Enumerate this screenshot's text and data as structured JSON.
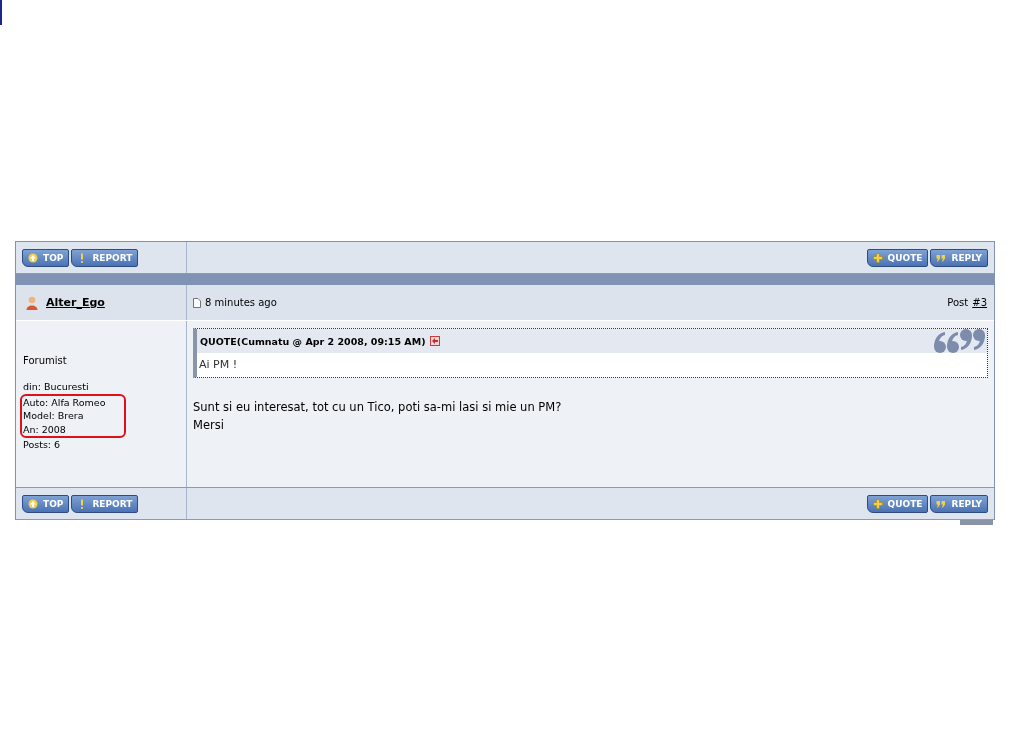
{
  "post": {
    "top_bar": {
      "left_buttons": [
        {
          "kind": "top",
          "label": "TOP"
        },
        {
          "kind": "report",
          "label": "REPORT"
        }
      ],
      "right_buttons": [
        {
          "kind": "quote",
          "label": "QUOTE"
        },
        {
          "kind": "reply",
          "label": "REPLY"
        }
      ]
    },
    "author": {
      "name": "Alter_Ego",
      "group": "Forumist",
      "profile": [
        {
          "text": "din: Bucuresti",
          "highlighted": false
        },
        {
          "text": "Auto: Alfa Romeo",
          "highlighted": true
        },
        {
          "text": "Model: Brera",
          "highlighted": true
        },
        {
          "text": "An: 2008",
          "highlighted": true
        },
        {
          "text": "Posts: 6",
          "highlighted": false
        }
      ]
    },
    "time": "8 minutes ago",
    "post_label": "Post",
    "post_number": "#3",
    "quote": {
      "header": "QUOTE(Cumnatu @ Apr 2 2008, 09:15 AM)",
      "text": "Ai PM !"
    },
    "body": [
      "Sunt si eu interesat, tot cu un Tico, poti sa-mi lasi si mie un PM?",
      "Mersi"
    ],
    "bottom_bar": {
      "left_buttons": [
        {
          "kind": "top",
          "label": "TOP"
        },
        {
          "kind": "report",
          "label": "REPORT"
        }
      ],
      "right_buttons": [
        {
          "kind": "quote",
          "label": "QUOTE"
        },
        {
          "kind": "reply",
          "label": "REPLY"
        }
      ]
    }
  }
}
